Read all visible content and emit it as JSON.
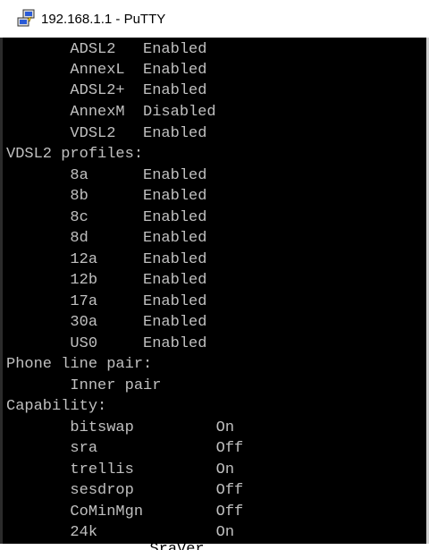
{
  "window": {
    "title": "192.168.1.1 - PuTTY",
    "icon": "putty-icon"
  },
  "terminal": {
    "lines": [
      "       ADSL2   Enabled",
      "       AnnexL  Enabled",
      "       ADSL2+  Enabled",
      "       AnnexM  Disabled",
      "       VDSL2   Enabled",
      "VDSL2 profiles:",
      "       8a      Enabled",
      "       8b      Enabled",
      "       8c      Enabled",
      "       8d      Enabled",
      "       12a     Enabled",
      "       12b     Enabled",
      "       17a     Enabled",
      "       30a     Enabled",
      "       US0     Enabled",
      "Phone line pair:",
      "       Inner pair",
      "Capability:",
      "       bitswap         On",
      "       sra             Off",
      "       trellis         On",
      "       sesdrop         Off",
      "       CoMinMgn        Off",
      "       24k             On"
    ],
    "partial_line": "       SraVer"
  },
  "colors": {
    "terminal_bg": "#000000",
    "terminal_fg": "#c0c0c0",
    "titlebar_bg": "#ffffff"
  }
}
